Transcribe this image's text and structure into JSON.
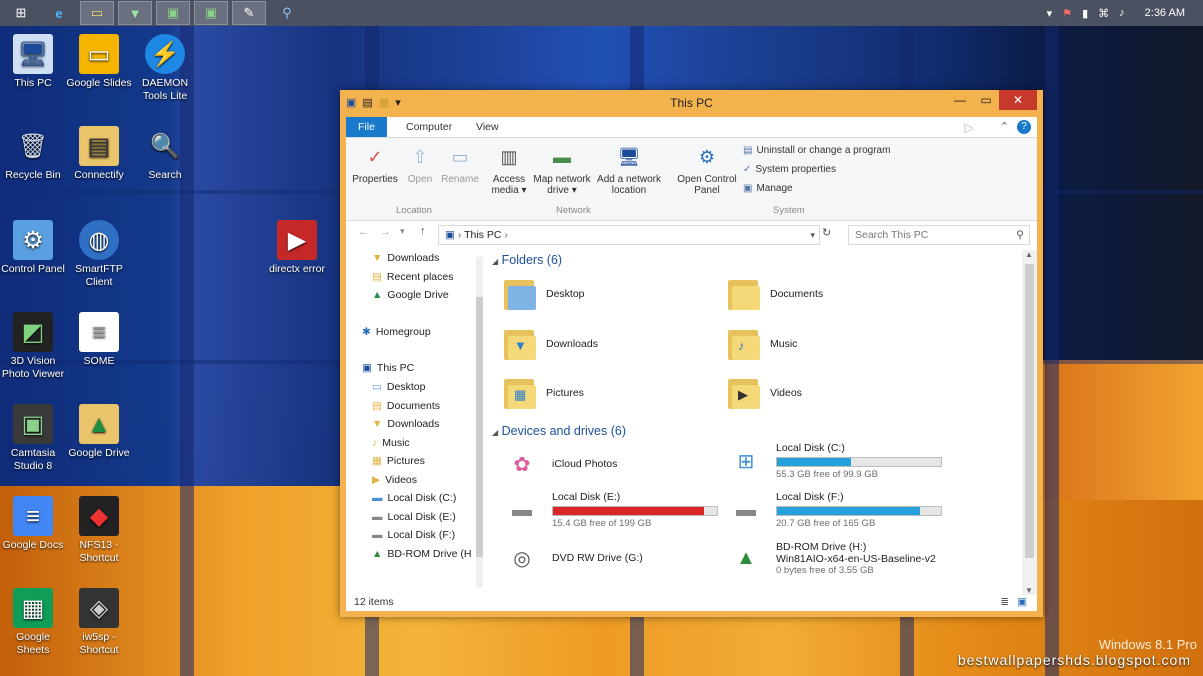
{
  "taskbar": {
    "clock": "2:36 AM",
    "apps": [
      "start-icon",
      "ie-icon",
      "explorer-icon",
      "vyapin-icon",
      "camtasia-icon",
      "camtasia2-icon",
      "gimp-icon",
      "search-icon"
    ]
  },
  "desktop": {
    "icons": [
      {
        "label": "This PC"
      },
      {
        "label": "Google Slides"
      },
      {
        "label": "DAEMON Tools Lite"
      },
      {
        "label": "Recycle Bin"
      },
      {
        "label": "Connectify"
      },
      {
        "label": "Search"
      },
      {
        "label": "Control Panel"
      },
      {
        "label": "SmartFTP Client"
      },
      {
        "label": "directx error"
      },
      {
        "label": "3D Vision Photo Viewer"
      },
      {
        "label": "SOME"
      },
      {
        "label": "Camtasia Studio 8"
      },
      {
        "label": "Google Drive"
      },
      {
        "label": "Google Docs"
      },
      {
        "label": "NFS13 - Shortcut"
      },
      {
        "label": "Google Sheets"
      },
      {
        "label": "iw5sp - Shortcut"
      }
    ],
    "watermark": "bestwallpapershds.blogspot.com",
    "winver": "Windows 8.1 Pro"
  },
  "window": {
    "title": "This PC",
    "tabs": [
      "File",
      "Computer",
      "View"
    ],
    "ribbon": {
      "location": {
        "label": "Location",
        "buttons": [
          "Properties",
          "Open",
          "Rename"
        ]
      },
      "network": {
        "label": "Network",
        "buttons": [
          "Access media ▾",
          "Map network drive ▾",
          "Add a network location"
        ]
      },
      "system": {
        "label": "System",
        "open_cp": "Open Control Panel",
        "links": [
          "Uninstall or change a program",
          "System properties",
          "Manage"
        ]
      }
    },
    "address": {
      "path": "This PC",
      "search_placeholder": "Search This PC"
    },
    "nav": {
      "items": [
        "Downloads",
        "Recent places",
        "Google Drive",
        "Homegroup",
        "This PC",
        "Desktop",
        "Documents",
        "Downloads",
        "Music",
        "Pictures",
        "Videos",
        "Local Disk (C:)",
        "Local Disk (E:)",
        "Local Disk (F:)",
        "BD-ROM Drive (H"
      ]
    },
    "folders": {
      "header": "Folders (6)",
      "items": [
        "Desktop",
        "Documents",
        "Downloads",
        "Music",
        "Pictures",
        "Videos"
      ]
    },
    "devices": {
      "header": "Devices and drives (6)",
      "items": [
        {
          "name": "iCloud Photos"
        },
        {
          "name": "Local Disk (C:)",
          "free": "55.3 GB free of 99.9 GB",
          "used_fraction": 0.45,
          "bar_color": "#26a0da"
        },
        {
          "name": "Local Disk (E:)",
          "free": "15.4 GB free of 199 GB",
          "used_fraction": 0.92,
          "bar_color": "#da2626"
        },
        {
          "name": "Local Disk (F:)",
          "free": "20.7 GB free of 165 GB",
          "used_fraction": 0.87,
          "bar_color": "#26a0da"
        },
        {
          "name": "DVD RW Drive (G:)"
        },
        {
          "name": "BD-ROM Drive (H:)",
          "sub": "Win81AIO-x64-en-US-Baseline-v2",
          "free": "0 bytes free of 3.55 GB"
        }
      ]
    },
    "status": "12 items"
  }
}
